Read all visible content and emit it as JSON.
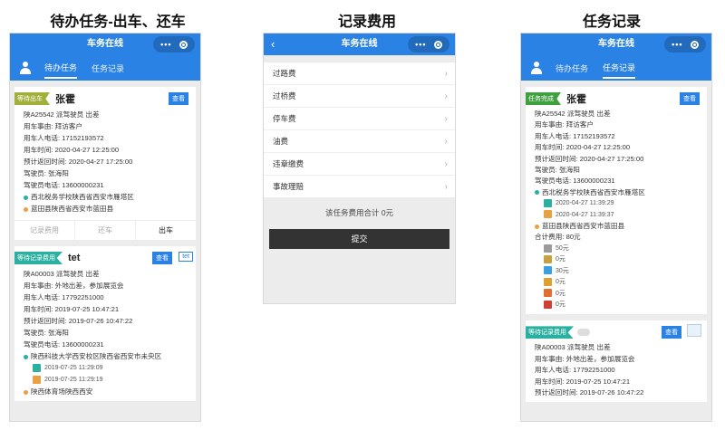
{
  "captions": {
    "left": "待办任务-出车、还车",
    "middle": "记录费用",
    "right": "任务记录"
  },
  "app": {
    "title": "车务在线",
    "dots": "•••"
  },
  "tabs": {
    "todo": "待办任务",
    "record": "任务记录"
  },
  "left": {
    "card1": {
      "badge": "等待出车",
      "name": "张霍",
      "tag": "查看",
      "l1": "陕A25542  派驾驶员    出差",
      "l2": "用车事由:    拜访客户",
      "l3": "用车人电话:   17152193572",
      "l4": "用车时间:     2020-04-27 12:25:00",
      "l5": "预计返回时间:   2020-04-27 17:25:00",
      "l6": "驾驶员:    张海阳",
      "l7": "驾驶员电话:   13600000231",
      "p1": "西北税务学校陕西省西安市雁塔区",
      "p2": "蓝田县陕西省西安市蓝田县",
      "a1": "记录费用",
      "a2": "还车",
      "a3": "出车"
    },
    "card2": {
      "badge": "等待记录费用",
      "name": "tet",
      "tag": "查看",
      "tag2": "tet",
      "l1": "陕A00003  派驾驶员    出差",
      "l2": "用车事由:    外地出差，参加展览会",
      "l3": "用车人电话:   17792251000",
      "l4": "用车时间:     2019-07-25 10:47:21",
      "l5": "预计返回时间:   2019-07-26 10:47:22",
      "l6": "驾驶员:    张海阳",
      "l7": "驾驶员电话:   13600000231",
      "p1": "陕西科技大学西安校区陕西省西安市未央区",
      "s1": "2019-07-25 11:29:09",
      "s2": "2019-07-25 11:29:19",
      "p2": "陕西体育场陕西西安"
    }
  },
  "middle": {
    "back": "‹",
    "fees": [
      "过路费",
      "过桥费",
      "停车费",
      "油费",
      "违章缴费",
      "事故理赔"
    ],
    "total": "该任务费用合计 0元",
    "submit": "提交"
  },
  "right": {
    "card1": {
      "badge": "任务完成",
      "name": "张霍",
      "tag": "查看",
      "l1": "陕A25542  派驾驶员    出差",
      "l2": "用车事由:    拜访客户",
      "l3": "用车人电话:   17152193572",
      "l4": "用车时间:     2020-04-27 12:25:00",
      "l5": "预计返回时间:   2020-04-27 17:25:00",
      "l6": "驾驶员:    张海阳",
      "l7": "驾驶员电话:   13600000231",
      "p1": "西北税务学校陕西省西安市雁塔区",
      "s1": "2020-04-27 11:39:29",
      "s2": "2020-04-27 11:39:37",
      "p2": "蓝田县陕西省西安市蓝田县",
      "sum": "合计费用:    80元",
      "fees": [
        "50元",
        "0元",
        "30元",
        "0元",
        "0元",
        "0元"
      ]
    },
    "card2": {
      "badge": "等待记录费用",
      "tag": "查看",
      "l1": "陕A00003  派驾驶员    出差",
      "l2": "用车事由:    外地出差，参加展览会",
      "l3": "用车人电话:   17792251000",
      "l4": "用车时间:     2019-07-25 10:47:21",
      "l5": "预计返回时间:   2019-07-26 10:47:22"
    }
  },
  "colors": {
    "primary": "#2a82e4",
    "fee_icons": [
      "#9a9a9a",
      "#c8a040",
      "#3aa0e0",
      "#e0a030",
      "#e07030",
      "#d04030"
    ]
  }
}
